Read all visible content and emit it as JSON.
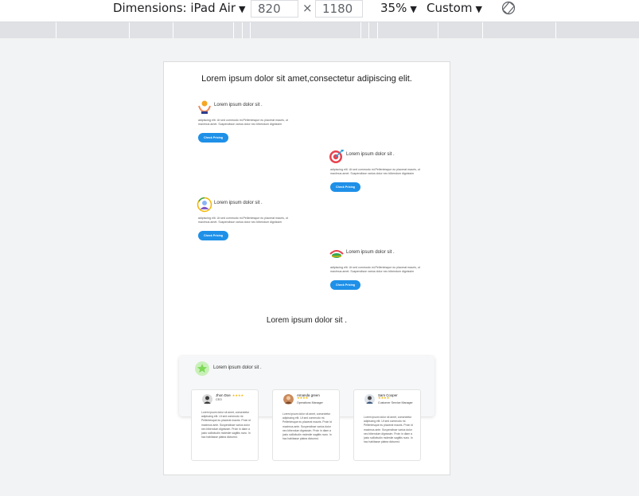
{
  "toolbar": {
    "dimensions_label": "Dimensions: iPad Air",
    "width_value": "820",
    "times": "×",
    "height_value": "1180",
    "zoom_label": "35%",
    "throttle_label": "Custom",
    "rotate_icon": "rotate-icon",
    "dropdown_icon": "caret-down-icon"
  },
  "page": {
    "heading": "Lorem ipsum dolor sit amet,consectetur adipiscing elit.",
    "features": [
      {
        "title": "Lorem ipsum dolor sit .",
        "description": "adipiscing elit. Ut sed commodo mi.Pellentesque eu placerat mauris, ut maximus amet. Suspendisse varius dolor nec bibendum dignissim",
        "button": "Check Pricing",
        "icon": "hand-coin-icon"
      },
      {
        "title": "Lorem ipsum dolor sit .",
        "description": "adipiscing elit. Ut sed commodo mi.Pellentesque eu placerat mauris, ut maximus amet. Suspendisse varius dolor nec bibendum dignissim",
        "button": "Check Pricing",
        "icon": "target-icon"
      },
      {
        "title": "Lorem ipsum dolor sit .",
        "description": "adipiscing elit. Ut sed commodo mi.Pellentesque eu placerat mauris, ut maximus amet. Suspendisse varius dolor nec bibendum dignissim",
        "button": "Check Pricing",
        "icon": "user-circle-icon"
      },
      {
        "title": "Lorem ipsum dolor sit .",
        "description": "adipiscing elit. Ut sed commodo mi.Pellentesque eu placerat mauris, ut maximus amet. Suspendisse varius dolor nec bibendum dignissim",
        "button": "Check Pricing",
        "icon": "handshake-icon"
      }
    ],
    "section_title": "Lorem ipsum dolor sit .",
    "testimonials_title": "Lorem ipsum dolor sit .",
    "testimonials": [
      {
        "name": "Jhon Doe",
        "stars": "★★★★",
        "role": "CEO",
        "review": "Lorem ipsum dolor sit amet, consectetur adipiscing elit. Ut sed commodo mi. Pellentesque eu placerat mauris. Proin id maximus ante. Suspendisse varius dolor nec bibendum dignissim. Proin in diam a justo sollicitudin molestie sagittis nunc. In hac habitasse platea dictumst."
      },
      {
        "name": "Amanda green",
        "stars": "★★★★",
        "role": "Operations Manager",
        "review": "Lorem ipsum dolor sit amet, consectetur adipiscing elit. Ut sed commodo mi. Pellentesque eu placerat mauris. Proin id maximus ante. Suspendisse varius dolor nec bibendum dignissim. Proin in diam a justo sollicitudin molestie sagittis nunc. In hac habitasse platea dictumst."
      },
      {
        "name": "Sam Cooper",
        "stars": "★★★★",
        "role": "Customer Service Manager",
        "review": "Lorem ipsum dolor sit amet, consectetur adipiscing elit. Ut sed commodo mi. Pellentesque eu placerat mauris. Proin id maximus ante. Suspendisse varius dolor nec bibendum dignissim. Proin in diam a justo sollicitudin molestie sagittis nunc. In hac habitasse platea dictumst."
      }
    ]
  },
  "colors": {
    "button": "#1e90e8",
    "stars": "#f4b400",
    "canvas": "#f1f3f4"
  }
}
